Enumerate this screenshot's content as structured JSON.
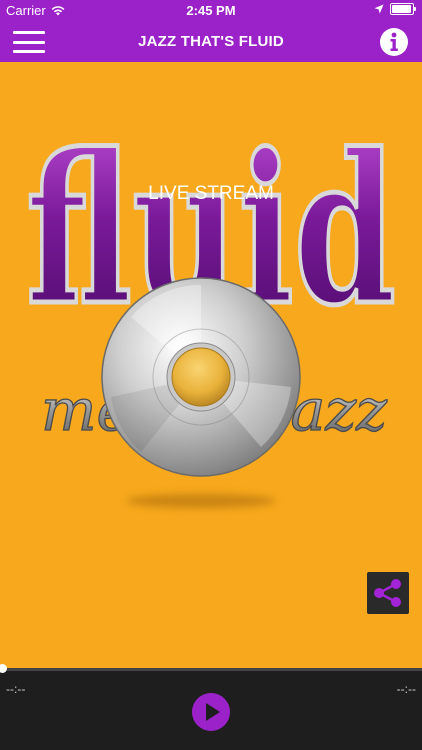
{
  "status_bar": {
    "carrier": "Carrier",
    "time": "2:45 PM"
  },
  "nav": {
    "title": "JAZZ THAT'S FLUID"
  },
  "main": {
    "background_color": "#f7a81c",
    "logo_primary": "fluid",
    "logo_secondary": "mellow jazz",
    "stream_label": "LIVE STREAM"
  },
  "player": {
    "elapsed": "--:--",
    "duration": "--:--",
    "progress": 0
  },
  "colors": {
    "accent": "#9b22c8",
    "player_bg": "#1e1e1e"
  },
  "icons": {
    "menu": "hamburger-icon",
    "info": "info-icon",
    "share": "share-icon",
    "play": "play-icon"
  }
}
